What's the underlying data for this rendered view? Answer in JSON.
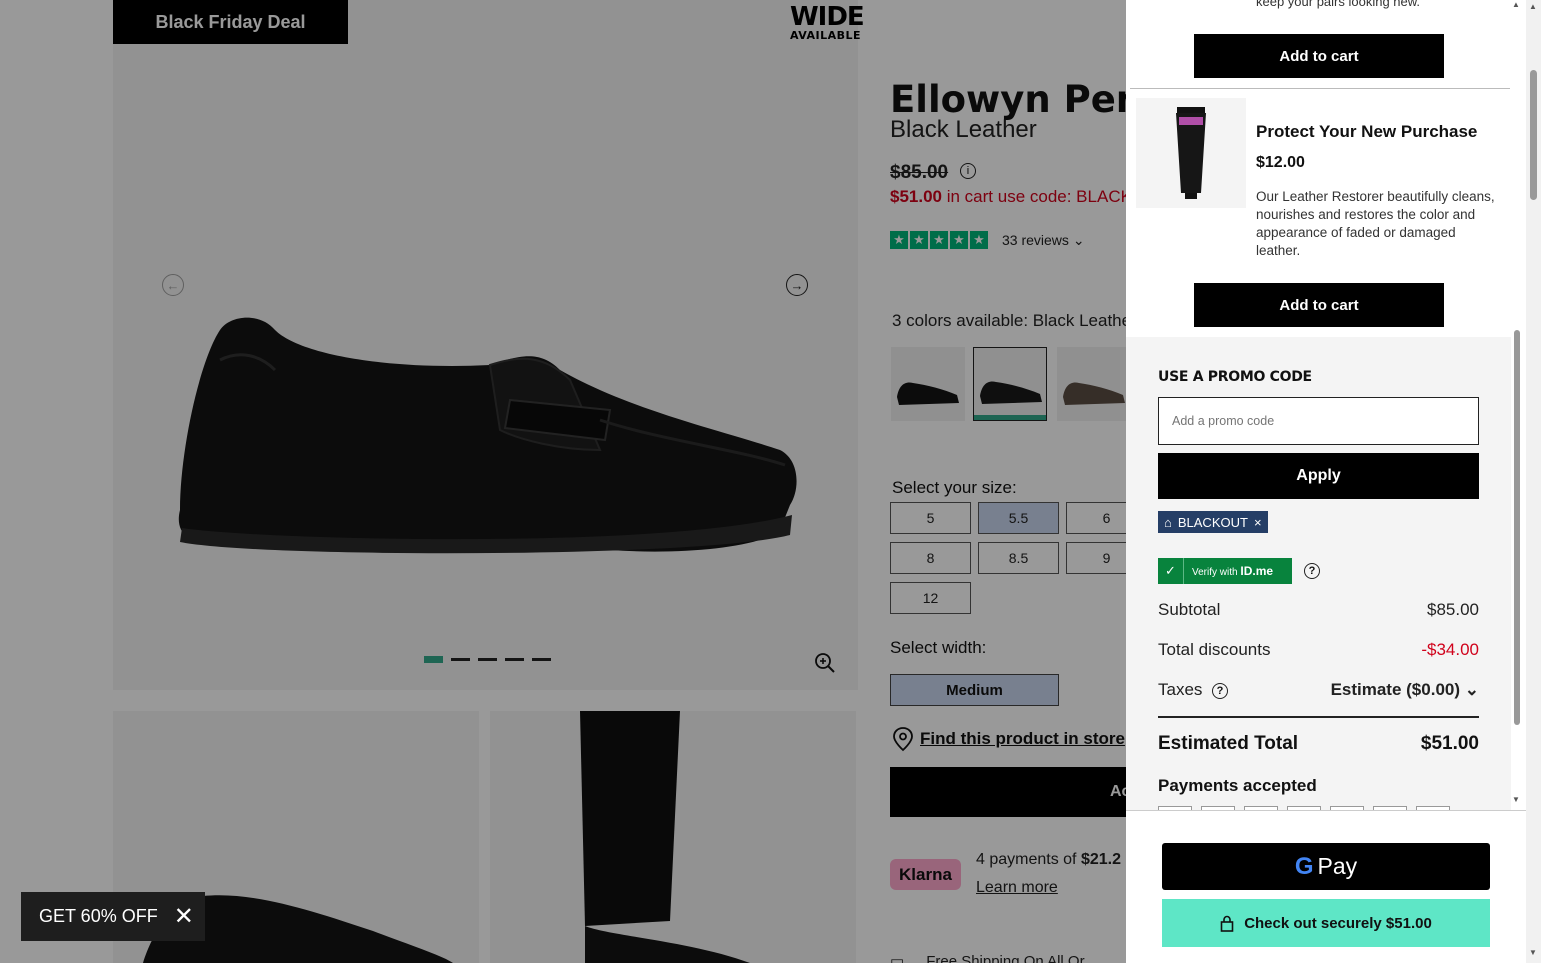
{
  "product": {
    "badge": "Black Friday Deal",
    "wide_line1": "WIDE",
    "wide_line2": "AVAILABLE",
    "title": "Ellowyn Pen",
    "color_name": "Black Leather",
    "old_price": "$85.00",
    "cart_price": "$51.00",
    "cart_price_suffix": " in cart use code: BLACK",
    "rating_stars": 5,
    "reviews": "33 reviews",
    "colors_label": "3 colors available: Black Leathe",
    "size_label": "Select your size:",
    "sizes": [
      "5",
      "5.5",
      "6",
      "8",
      "8.5",
      "9",
      "12"
    ],
    "selected_size": "5.5",
    "width_label": "Select width:",
    "width_value": "Medium",
    "find_store": "Find this product in store",
    "add_to_bag": "Ac",
    "klarna_logo": "Klarna",
    "klarna_text": "4 payments of ",
    "klarna_amount": "$21.2",
    "klarna_more": "Learn more",
    "shipping_text": "Free Shipping On All Or"
  },
  "popup": {
    "label": "GET 60% OFF"
  },
  "cart": {
    "keep_text": "keep your pairs looking new.",
    "add_to_cart": "Add to cart",
    "upsell": {
      "title": "Protect Your New Purchase",
      "price": "$12.00",
      "description": "Our Leather Restorer beautifully cleans, nourishes and restores the color and appearance of faded or damaged leather."
    },
    "promo": {
      "heading": "USE A PROMO CODE",
      "placeholder": "Add a promo code",
      "apply": "Apply",
      "applied_code": "BLACKOUT"
    },
    "idme": {
      "prefix": "Verify with",
      "brand": "ID.me"
    },
    "summary": {
      "subtotal_label": "Subtotal",
      "subtotal_value": "$85.00",
      "discount_label": "Total discounts",
      "discount_value": "-$34.00",
      "taxes_label": "Taxes",
      "taxes_value": "Estimate ($0.00)",
      "total_label": "Estimated Total",
      "total_value": "$51.00",
      "payments_label": "Payments accepted"
    },
    "gpay_label": "Pay",
    "checkout_label": "Check out securely $51.00"
  },
  "colors": {
    "accent": "#33a88a",
    "checkout_bg": "#5ee6c6",
    "discount_red": "#d0021b",
    "selected_size_bg": "#c9d6ee",
    "idme_green": "#08833d",
    "chip_blue": "#253e66"
  }
}
